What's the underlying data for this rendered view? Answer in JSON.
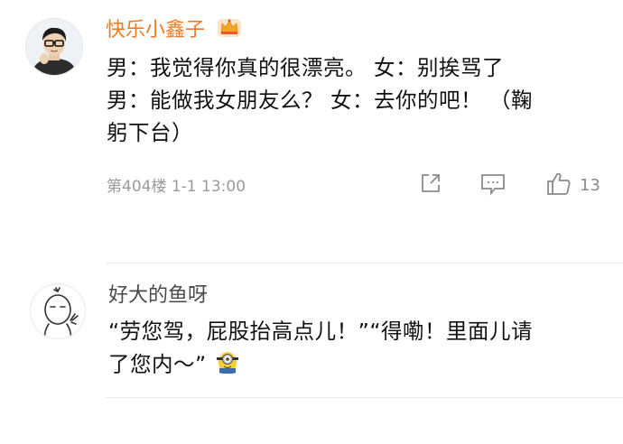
{
  "comments": [
    {
      "username": "快乐小鑫子",
      "username_color": "#f07a21",
      "vip_badge_icon": "crown-icon",
      "text_lines": [
        "男：我觉得你真的很漂亮。 女：别挨骂了",
        "男：能做我女朋友么？ 女：去你的吧！ （鞠",
        "躬下台）"
      ],
      "floor_info": "第404楼  1-1 13:00",
      "actions": {
        "share_icon": "share-icon",
        "comment_icon": "comment-icon",
        "like_icon": "thumbs-up-icon",
        "like_count": "13"
      }
    },
    {
      "username": "好大的鱼呀",
      "username_color": "#4a4a4a",
      "text_lines": [
        "“劳您驾，屁股抬高点儿！”“得嘞！里面儿请",
        "了您内～”"
      ],
      "emoji_icon": "minion-emoji-icon"
    }
  ]
}
